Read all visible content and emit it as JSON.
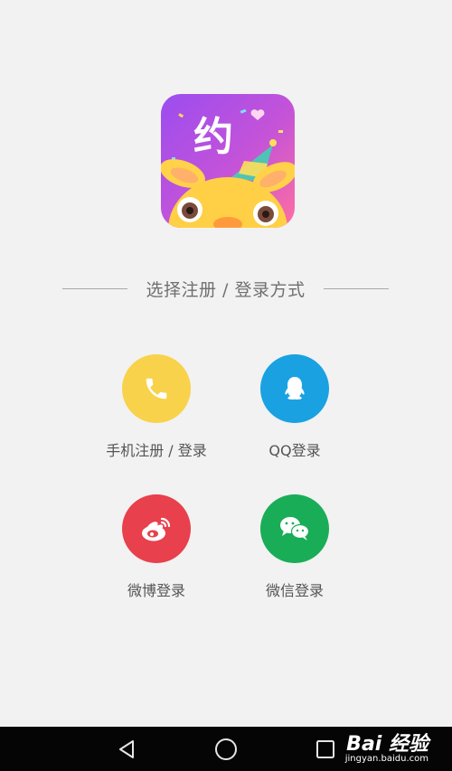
{
  "app_logo": {
    "glyph": "约",
    "icon": "app-logo-icon"
  },
  "divider": {
    "text": "选择注册 / 登录方式"
  },
  "options": [
    {
      "label": "手机注册 / 登录",
      "icon": "phone-icon",
      "color": "#f8d24a"
    },
    {
      "label": "QQ登录",
      "icon": "qq-penguin-icon",
      "color": "#1aa1e2"
    },
    {
      "label": "微博登录",
      "icon": "weibo-icon",
      "color": "#e8404c"
    },
    {
      "label": "微信登录",
      "icon": "wechat-icon",
      "color": "#1aad57"
    }
  ],
  "navbar": {
    "back": "back-triangle-icon",
    "home": "home-circle-icon",
    "recent": "recent-square-icon"
  },
  "watermark": {
    "brand": "Bai 经验",
    "url": "jingyan.baidu.com"
  }
}
